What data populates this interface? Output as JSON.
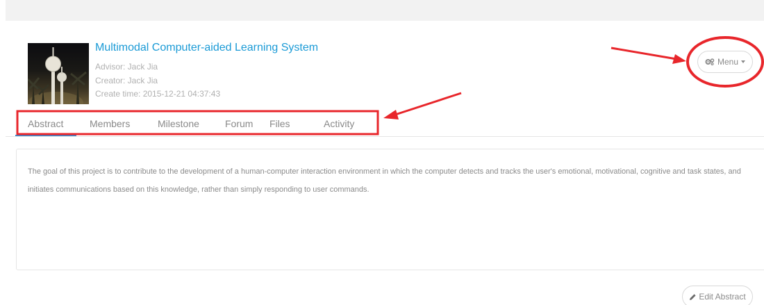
{
  "project": {
    "title": "Multimodal Computer-aided Learning System",
    "advisor": "Advisor: Jack Jia",
    "creator": "Creator: Jack Jia",
    "created": "Create time: 2015-12-21 04:37:43",
    "thumbnail_icon": "night-towers-photo"
  },
  "menu": {
    "label": "Menu",
    "icon": "gears-icon"
  },
  "tabs": [
    {
      "label": "Abstract",
      "active": true
    },
    {
      "label": "Members",
      "active": false
    },
    {
      "label": "Milestone",
      "active": false
    },
    {
      "label": "Forum",
      "active": false
    },
    {
      "label": "Files",
      "active": false
    },
    {
      "label": "Activity",
      "active": false
    }
  ],
  "abstract": {
    "text": "The goal of this project is to contribute to the development of a human-computer interaction environment in which the computer detects and tracks the user's emotional, motivational, cognitive and task states, and initiates communications based on this knowledge, rather than simply responding to user commands."
  },
  "edit_abstract": {
    "label": "Edit Abstract",
    "icon": "pencil-icon"
  },
  "colors": {
    "link_blue": "#1a9ad6",
    "tab_active": "#2d8fd6",
    "annotation_red": "#e8262b",
    "muted_text": "#8a8a8a"
  }
}
